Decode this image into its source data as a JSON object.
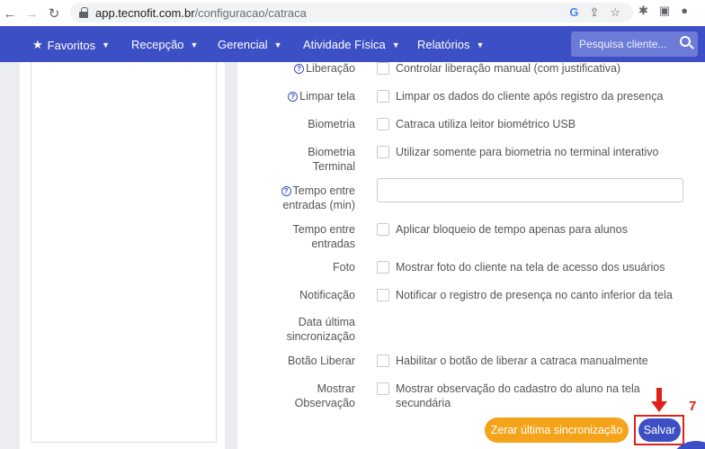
{
  "browser": {
    "url_host": "app.tecnofit.com.br",
    "url_path": "/configuracao/catraca"
  },
  "navbar": {
    "items": [
      {
        "label": "Favoritos"
      },
      {
        "label": "Recepção"
      },
      {
        "label": "Gerencial"
      },
      {
        "label": "Atividade Física"
      },
      {
        "label": "Relatórios"
      }
    ],
    "search_placeholder": "Pesquisa cliente..."
  },
  "settings": {
    "liberacao": {
      "label": "Liberação",
      "text": "Controlar liberação manual (com justificativa)"
    },
    "limpar_tela": {
      "label": "Limpar tela",
      "text": "Limpar os dados do cliente após registro da presença"
    },
    "biometria": {
      "label": "Biometria",
      "text": "Catraca utiliza leitor biométrico USB"
    },
    "biometria_terminal": {
      "label_1": "Biometria",
      "label_2": "Terminal",
      "text": "Utilizar somente para biometria no terminal interativo"
    },
    "tempo_entre_entradas_min": {
      "label_1": "Tempo entre",
      "label_2": "entradas (min)",
      "value": ""
    },
    "tempo_entre_entradas": {
      "label_1": "Tempo entre",
      "label_2": "entradas",
      "text": "Aplicar bloqueio de tempo apenas para alunos"
    },
    "foto": {
      "label": "Foto",
      "text": "Mostrar foto do cliente na tela de acesso dos usuários"
    },
    "notificacao": {
      "label": "Notificação",
      "text": "Notificar o registro de presença no canto inferior da tela"
    },
    "data_ultima_sinc": {
      "label_1": "Data última",
      "label_2": "sincronização"
    },
    "botao_liberar": {
      "label": "Botão Liberar",
      "text": "Habilitar o botão de liberar a catraca manualmente"
    },
    "mostrar_observacao": {
      "label_1": "Mostrar",
      "label_2": "Observação",
      "text_1": "Mostrar observação do cadastro do aluno na tela",
      "text_2": "secundária"
    }
  },
  "actions": {
    "reset_label": "Zerar última sincronização",
    "save_label": "Salvar"
  },
  "annotation": {
    "step_number": "7",
    "color": "#e0211a"
  },
  "colors": {
    "primary": "#3d4fc4",
    "warning": "#f5a31a"
  }
}
